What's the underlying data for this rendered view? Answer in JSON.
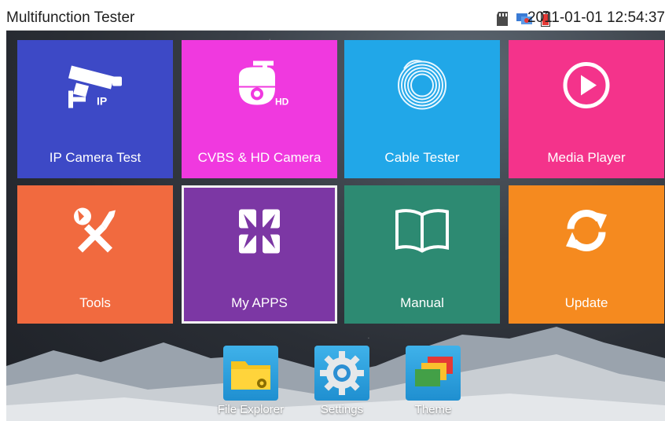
{
  "statusbar": {
    "title": "Multifunction Tester",
    "datetime": "2011-01-01 12:54:37",
    "icons": [
      "sd-card-icon",
      "network-icon",
      "battery-icon"
    ]
  },
  "tiles": [
    {
      "label": "IP Camera Test",
      "icon": "ip-camera-icon",
      "color": "#3d49c6"
    },
    {
      "label": "CVBS & HD Camera",
      "icon": "hd-camera-icon",
      "color": "#f039df"
    },
    {
      "label": "Cable Tester",
      "icon": "cable-icon",
      "color": "#21a7e8"
    },
    {
      "label": "Media Player",
      "icon": "play-icon",
      "color": "#f4338b"
    },
    {
      "label": "Tools",
      "icon": "tools-icon",
      "color": "#f16a3f"
    },
    {
      "label": "My APPS",
      "icon": "apps-icon",
      "color": "#7c37a4"
    },
    {
      "label": "Manual",
      "icon": "book-icon",
      "color": "#2d8a72"
    },
    {
      "label": "Update",
      "icon": "refresh-icon",
      "color": "#f58a1f"
    }
  ],
  "dock": [
    {
      "label": "File Explorer",
      "icon": "folder-icon"
    },
    {
      "label": "Settings",
      "icon": "gear-icon"
    },
    {
      "label": "Theme",
      "icon": "theme-icon"
    }
  ],
  "badges": {
    "ip": "IP",
    "hd": "HD"
  }
}
